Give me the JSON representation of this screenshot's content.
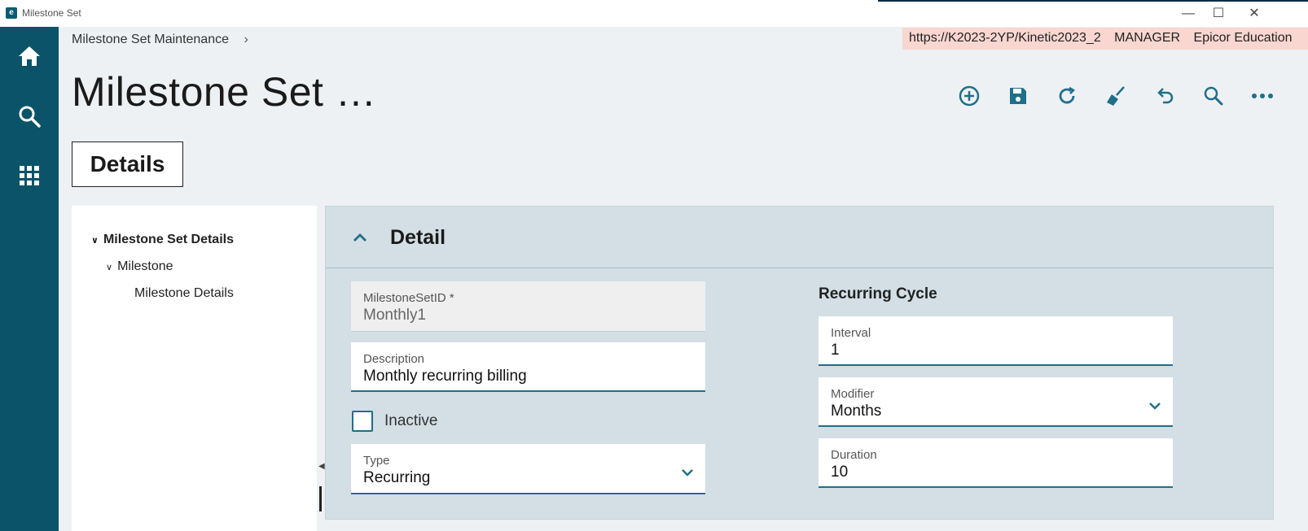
{
  "window": {
    "title": "Milestone Set",
    "minimize": "—",
    "maximize": "☐",
    "close": "✕"
  },
  "breadcrumb": {
    "item": "Milestone Set Maintenance",
    "chevron": "›"
  },
  "env": {
    "url": "https://K2023-2YP/Kinetic2023_2",
    "user": "MANAGER",
    "company": "Epicor Education"
  },
  "page": {
    "title": "Milestone Set …",
    "tab": "Details"
  },
  "tree": {
    "root": "Milestone Set Details",
    "child": "Milestone",
    "grandchild": "Milestone Details"
  },
  "detail": {
    "title": "Detail",
    "milestone_set_id": {
      "label": "MilestoneSetID *",
      "value": "Monthly1"
    },
    "description": {
      "label": "Description",
      "value": "Monthly recurring billing"
    },
    "inactive": {
      "label": "Inactive",
      "checked": false
    },
    "type": {
      "label": "Type",
      "value": "Recurring"
    },
    "recurring_cycle": {
      "title": "Recurring Cycle",
      "interval": {
        "label": "Interval",
        "value": "1"
      },
      "modifier": {
        "label": "Modifier",
        "value": "Months"
      },
      "duration": {
        "label": "Duration",
        "value": "10"
      }
    }
  },
  "colors": {
    "rail": "#0b5369",
    "accent": "#1f6f8b",
    "env_bg": "#f9d6d0",
    "card_bg": "#d3dfe4"
  },
  "icons": {
    "rail": [
      "home-icon",
      "search-icon",
      "apps-grid-icon"
    ],
    "toolbar": [
      "add-new-icon",
      "save-icon",
      "refresh-icon",
      "clear-icon",
      "undo-icon",
      "search-icon",
      "more-icon"
    ]
  }
}
